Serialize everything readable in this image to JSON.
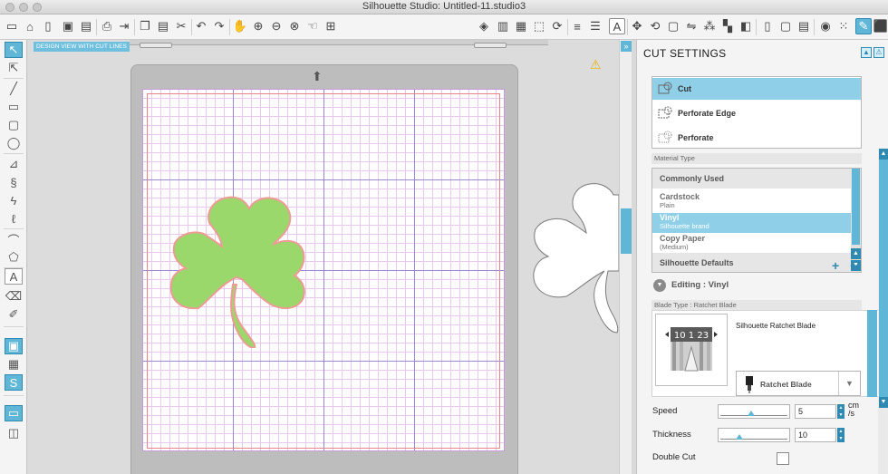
{
  "window": {
    "title": "Silhouette Studio: Untitled-11.studio3"
  },
  "toolbar": {
    "icons_left": [
      "new-icon",
      "open-icon",
      "new-page-icon",
      "save-icon",
      "save-as-icon",
      "print-icon",
      "send-icon",
      "copy-icon",
      "paste-icon",
      "cut-icon",
      "undo-icon",
      "redo-icon",
      "pan-icon",
      "zoom-in-icon",
      "zoom-out-icon",
      "zoom-fit-icon",
      "zoom-select-icon"
    ],
    "icons_right": [
      "eraser-icon",
      "page-setup-icon",
      "grid-icon",
      "transform-icon",
      "line-style-icon",
      "fill-icon",
      "text-style-icon",
      "replicate-icon",
      "rotate-icon",
      "align-icon",
      "knife-icon",
      "image-trace-icon",
      "send-to-silhouette-icon",
      "library-icon",
      "store-icon",
      "points-icon",
      "pattern-icon",
      "cut-settings-icon",
      "trace-icon"
    ]
  },
  "workspace": {
    "label": "DESIGN VIEW WITH CUT LINES",
    "warning_icon": "warning-icon"
  },
  "panel": {
    "title": "CUT SETTINGS",
    "cut_modes": [
      "Cut",
      "Perforate Edge",
      "Perforate"
    ],
    "selected_cut_mode": "Cut",
    "material_type_label": "Material Type",
    "materials_header": "Commonly Used",
    "materials": [
      {
        "name": "Cardstock",
        "sub": "Plain"
      },
      {
        "name": "Vinyl",
        "sub": "Silhouette brand"
      },
      {
        "name": "Copy Paper",
        "sub": "(Medium)"
      }
    ],
    "selected_material": "Vinyl",
    "defaults_header": "Silhouette Defaults",
    "add_label": "+",
    "remove_label": "−",
    "editing_label": "Editing : Vinyl",
    "blade_type_label": "Blade Type : Ratchet Blade",
    "blade_name": "Silhouette Ratchet Blade",
    "blade_select": "Ratchet Blade",
    "blade_dial": "10 1 23",
    "speed_label": "Speed",
    "speed_value": "5",
    "speed_unit": "cm\n/s",
    "thickness_label": "Thickness",
    "thickness_value": "10",
    "double_cut_label": "Double Cut"
  },
  "colors": {
    "accent": "#5fb6d6",
    "accent_dark": "#2f89b0",
    "clover_fill": "#9bd86c",
    "clover_stroke": "#ee9b95",
    "cut_line": "#e8838a"
  }
}
